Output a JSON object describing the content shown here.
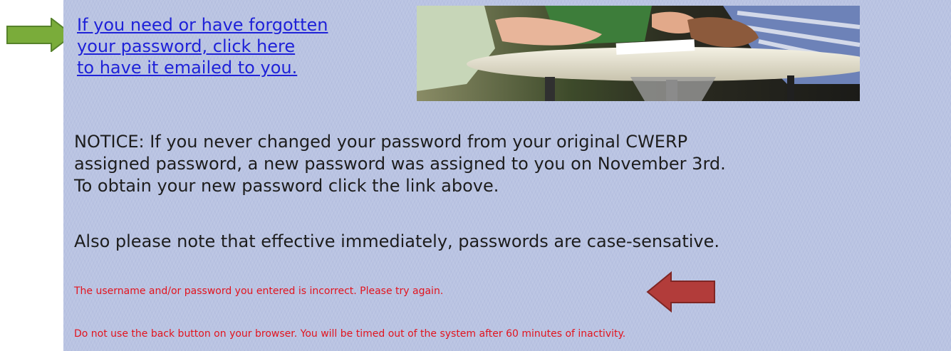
{
  "forgot_link": {
    "line1": "If you need or have forgotten",
    "line2": "your password, click here",
    "line3": "to have it emailed to you."
  },
  "notice": {
    "line1": "NOTICE: If you never changed your password from your original CWERP",
    "line2": "assigned password, a new password was assigned to you on November 3rd.",
    "line3": "To obtain your new password click the link above."
  },
  "case_note": "Also please note that effective immediately, passwords are case-sensative.",
  "error_message": "The username and/or password you entered is incorrect. Please try again.",
  "timeout_message": "Do not use the back button on your browser. You will be timed out of the system after 60 minutes of inactivity.",
  "colors": {
    "panel_background": "#b9c3e2",
    "link": "#1f22d8",
    "error_text": "#e2141e",
    "green_arrow": "#7aac3a",
    "red_arrow": "#b23c3a"
  },
  "icons": {
    "pointer_left": "green-arrow-icon",
    "pointer_right": "red-arrow-icon"
  }
}
